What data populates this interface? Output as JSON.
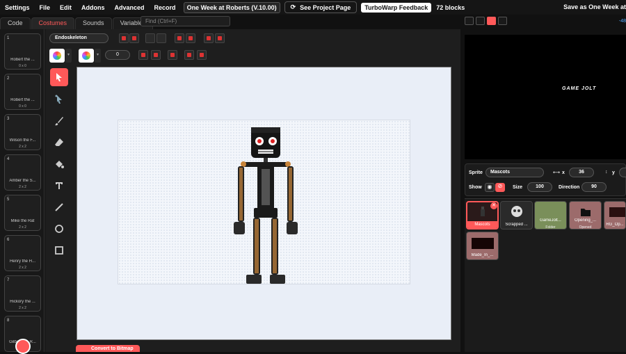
{
  "menu": {
    "items": [
      "Settings",
      "File",
      "Edit",
      "Addons",
      "Advanced",
      "Record"
    ],
    "project_title": "One Week at Roberts (V.10.00)",
    "see_project": "See Project Page",
    "feedback": "TurboWarp Feedback",
    "block_count": "72 blocks",
    "save_as": "Save as One Week at"
  },
  "tabs": [
    "Code",
    "Costumes",
    "Sounds",
    "Variables"
  ],
  "active_tab": "Costumes",
  "find_placeholder": "Find (Ctrl+F)",
  "stage_coord": "-48",
  "costumes": [
    {
      "num": "1",
      "name": "Robert the ...",
      "size": "0 x 0"
    },
    {
      "num": "2",
      "name": "Robert the ...",
      "size": "0 x 0"
    },
    {
      "num": "3",
      "name": "Wilson the F...",
      "size": "2 x 2"
    },
    {
      "num": "4",
      "name": "Amber the S...",
      "size": "2 x 2"
    },
    {
      "num": "5",
      "name": "Mike the Rat",
      "size": "2 x 2"
    },
    {
      "num": "6",
      "name": "Henry the H...",
      "size": "2 x 2"
    },
    {
      "num": "7",
      "name": "Hickory the ...",
      "size": "2 x 2"
    },
    {
      "num": "8",
      "name": "Gilbert the R...",
      "size": ""
    }
  ],
  "editor": {
    "costume_name": "Endoskeleton",
    "outline_width": "0",
    "convert_label": "Convert to Bitmap"
  },
  "stage": {
    "logo_text": "GAME JOLT"
  },
  "sprite_info": {
    "sprite_label": "Sprite",
    "sprite_name": "Mascots",
    "x_label": "x",
    "x_value": "36",
    "y_label": "y",
    "show_label": "Show",
    "size_label": "Size",
    "size_value": "100",
    "direction_label": "Direction",
    "direction_value": "90"
  },
  "sprites": [
    {
      "name": "Mascots",
      "sub": ""
    },
    {
      "name": "Scrapped ...",
      "sub": ""
    },
    {
      "name": "GameJolt...",
      "sub": "Folder"
    },
    {
      "name": "Opening_...",
      "sub": "Opened"
    },
    {
      "name": "RG_Op...",
      "sub": ""
    },
    {
      "name": "Made_In_...",
      "sub": ""
    }
  ],
  "colors": {
    "accent": "#ff5959",
    "bg": "#111111",
    "panel": "#1e1e1e",
    "canvas": "#e9eef7"
  }
}
